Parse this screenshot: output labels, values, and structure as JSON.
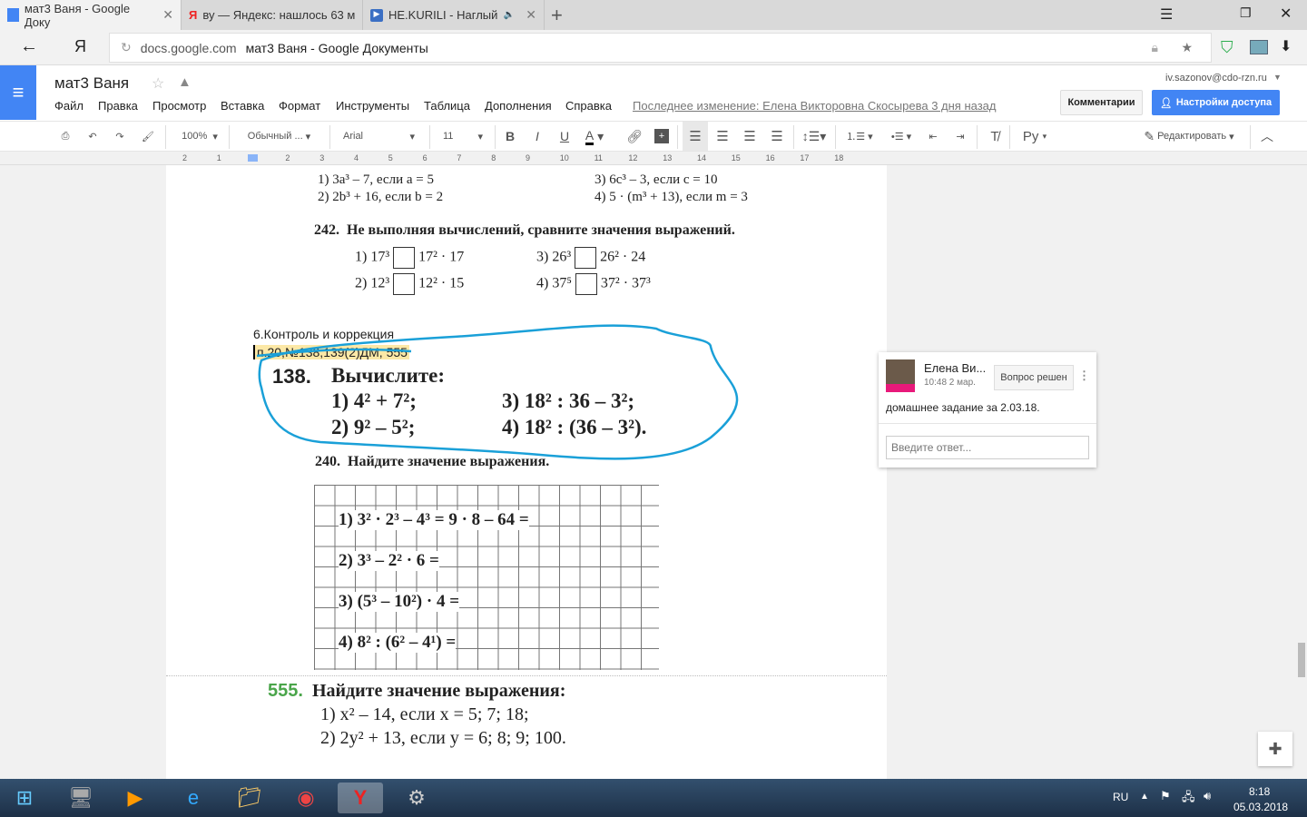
{
  "browser": {
    "tabs": [
      {
        "label": "мат3 Ваня - Google Доку",
        "icon": "docs-icon",
        "active": true
      },
      {
        "label": "ву — Яндекс: нашлось 63 м",
        "icon": "yandex-icon"
      },
      {
        "label": "НЕ.KURILI - Наглый",
        "icon": "video-icon"
      }
    ],
    "new_tab": "+",
    "yandex_logo": "Я",
    "url_domain": "docs.google.com",
    "url_title": "мат3 Ваня - Google Документы"
  },
  "docs": {
    "title": "мат3 Ваня",
    "menu": [
      "Файл",
      "Правка",
      "Просмотр",
      "Вставка",
      "Формат",
      "Инструменты",
      "Таблица",
      "Дополнения",
      "Справка"
    ],
    "last_edit": "Последнее изменение: Елена Викторовна Скосырева 3 дня назад",
    "account": "iv.sazonov@cdo-rzn.ru",
    "comments_btn": "Комментарии",
    "share_btn": "Настройки доступа",
    "accent": "#4285f4"
  },
  "toolbar": {
    "zoom": "100%",
    "style": "Обычный ...",
    "font": "Arial",
    "size": "11",
    "input_tools": "Ру",
    "mode": "Редактировать"
  },
  "ruler": [
    "2",
    "1",
    "1",
    "2",
    "3",
    "4",
    "5",
    "6",
    "7",
    "8",
    "9",
    "10",
    "11",
    "12",
    "13",
    "14",
    "15",
    "16",
    "17",
    "18"
  ],
  "content": {
    "top_lines": [
      "1) 3a³ – 7, если a = 5",
      "2) 2b³ + 16, если b = 2",
      "3) 6c³ – 3, если c = 10",
      "4) 5 · (m³ + 13), если m = 3"
    ],
    "ex242_num": "242.",
    "ex242_title": "Не выполняя вычислений, сравните значения выражений.",
    "ex242": [
      [
        "1) 17³",
        "17² · 17"
      ],
      [
        "3) 26³",
        "26² · 24"
      ],
      [
        "2) 12³",
        "12² · 15"
      ],
      [
        "4) 37⁵",
        "37² · 37³"
      ]
    ],
    "section": "6.Контроль и коррекция",
    "homework": "п.20,№138,139(2)ДМ, 555",
    "ex138_num": "138.",
    "ex138_title": "Вычислите:",
    "ex138": [
      "1) 4² + 7²;",
      "3) 18² : 36 – 3²;",
      "2) 9² – 5²;",
      "4) 18² : (36 – 3²)."
    ],
    "ex240_num": "240.",
    "ex240_title": "Найдите значение выражения.",
    "ex240": [
      "1) 3² · 2³ – 4³ = 9 · 8 – 64 =",
      "2) 3³ – 2² · 6 =",
      "3) (5³ – 10²) · 4 =",
      "4) 8² : (6² – 4¹) ="
    ],
    "ex555_num": "555.",
    "ex555_title": "Найдите значение выражения:",
    "ex555": [
      "1) x² – 14, если x = 5; 7; 18;",
      "2) 2y² + 13, если y = 6; 8; 9; 100."
    ]
  },
  "comment": {
    "author": "Елена Ви...",
    "time": "10:48 2 мар.",
    "resolve": "Вопрос решен",
    "text": "домашнее задание за 2.03.18.",
    "reply_placeholder": "Введите ответ..."
  },
  "taskbar": {
    "lang": "RU",
    "time": "8:18",
    "date": "05.03.2018"
  }
}
